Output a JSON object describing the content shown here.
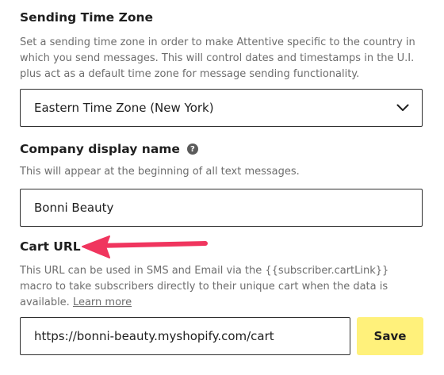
{
  "time_zone": {
    "title": "Sending Time Zone",
    "description": "Set a sending time zone in order to make Attentive specific to the country in which you send messages. This will control dates and timestamps in the U.I. plus act as a default time zone for message sending functionality.",
    "selected": "Eastern Time Zone (New York)",
    "dropdown_icon": "chevron-down-icon"
  },
  "company_name": {
    "title": "Company display name",
    "help_icon": "question-mark",
    "description": "This will appear at the beginning of all text messages.",
    "value": "Bonni Beauty"
  },
  "cart_url": {
    "title": "Cart URL",
    "description": "This URL can be used in SMS and Email via the {{subscriber.cartLink}} macro to take subscribers directly to their unique cart when the data is available.",
    "link_text": "Learn more",
    "value": "https://bonni-beauty.myshopify.com/cart",
    "save_label": "Save",
    "save_color": "#fff17b"
  },
  "annotation": {
    "arrow_icon": "arrow-left-icon",
    "arrow_color": "#f0355e"
  },
  "help_glyph": "?"
}
